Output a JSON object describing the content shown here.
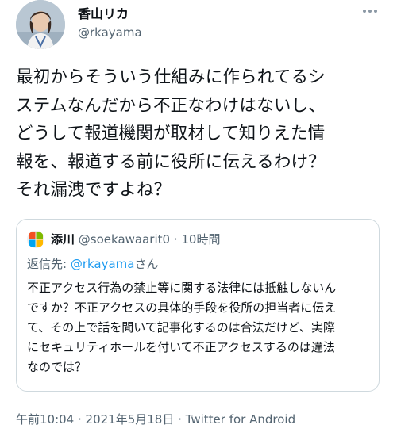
{
  "author": {
    "name": "香山リカ",
    "handle": "@rkayama",
    "more_icon": "ellipsis-icon"
  },
  "tweet": {
    "text": "最初からそういう仕組みに作られてるシ\nステムなんだから不正なわけはないし、\nどうして報道機関が取材して知りえた情\n報を、報道する前に役所に伝えるわけ？\nそれ漏洩ですよね？"
  },
  "quoted": {
    "name": "添川",
    "handle": "@soekawaarit0",
    "separator": "·",
    "time": "10時間",
    "reply_prefix": "返信先: ",
    "reply_handle": "@rkayama",
    "reply_suffix": "さん",
    "text": "不正アクセス行為の禁止等に関する法律には抵触しないん\nですか？不正アクセスの具体的手段を役所の担当者に伝え\nて、その上で話を聞いて記事化するのは合法だけど、実際\nにセキュリティホールを付いて不正アクセスするのは違法\nなのでは？"
  },
  "meta": {
    "time": "午前10:04",
    "sep1": " · ",
    "date": "2021年5月18日",
    "sep2": " · ",
    "source": "Twitter for Android"
  },
  "colors": {
    "text": "#0f1419",
    "secondary": "#536471",
    "link": "#1d9bf0",
    "border": "#cfd9de"
  }
}
